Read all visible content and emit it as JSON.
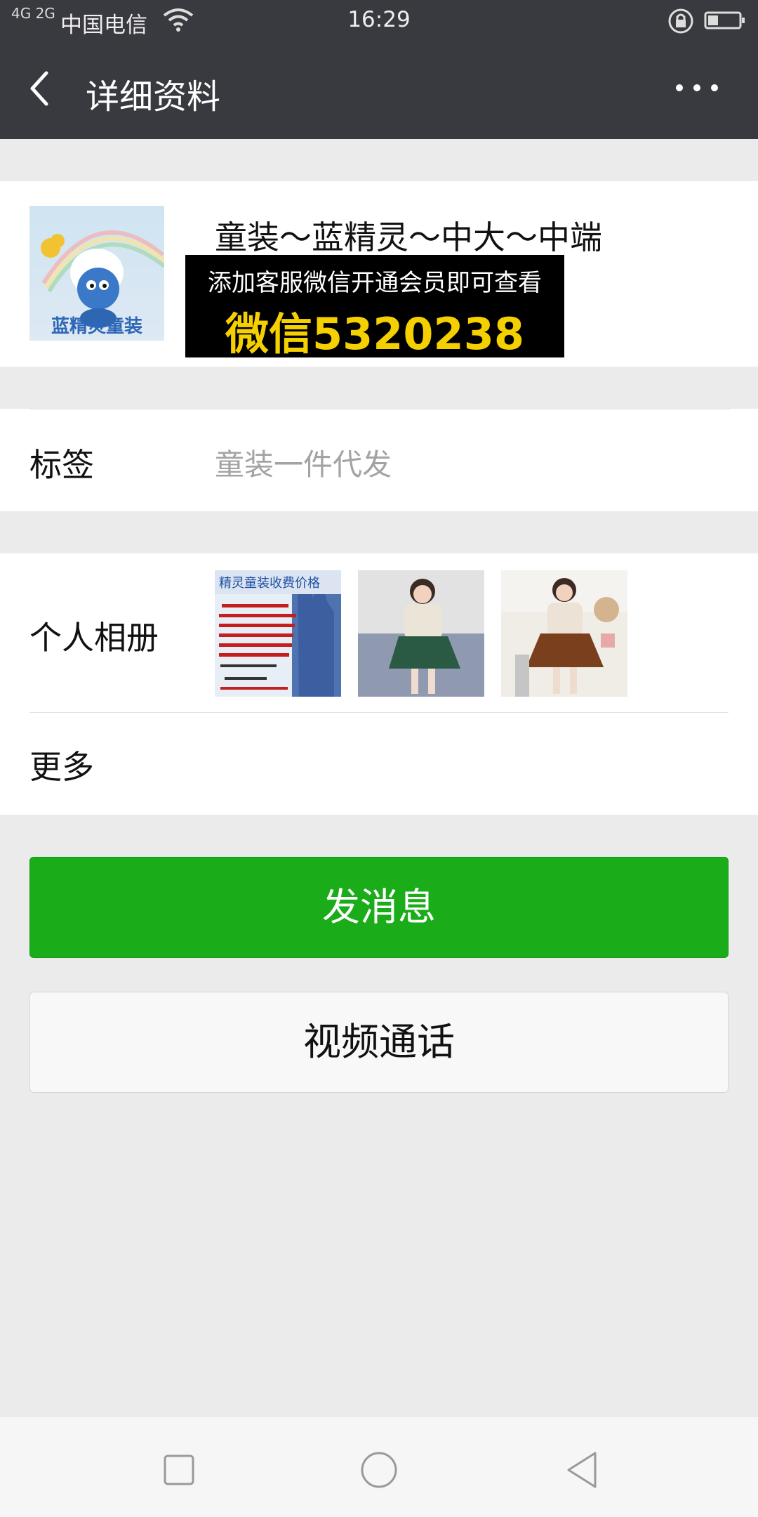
{
  "status_bar": {
    "signal": "4G 2G",
    "carrier": "中国电信",
    "time": "16:29"
  },
  "header": {
    "title": "详细资料",
    "back_icon": "chevron-left-icon",
    "more_icon": "more-dots-icon"
  },
  "profile": {
    "name": "童装～蓝精灵～中大～中端",
    "avatar_caption": "蓝精灵童装",
    "promo": {
      "line1": "添加客服微信开通会员即可查看",
      "line2": "微信5320238"
    }
  },
  "tag_row": {
    "label": "标签",
    "value": "童装一件代发"
  },
  "album": {
    "label": "个人相册",
    "thumbs": [
      {
        "caption": "精灵童装收费价格"
      },
      {
        "caption": ""
      },
      {
        "caption": ""
      }
    ]
  },
  "more_row": {
    "label": "更多"
  },
  "buttons": {
    "send_message": "发消息",
    "video_call": "视频通话"
  },
  "colors": {
    "header_bg": "#393a3f",
    "primary_green": "#1aad19",
    "page_bg": "#ebebeb",
    "promo_yellow": "#f5d000"
  }
}
